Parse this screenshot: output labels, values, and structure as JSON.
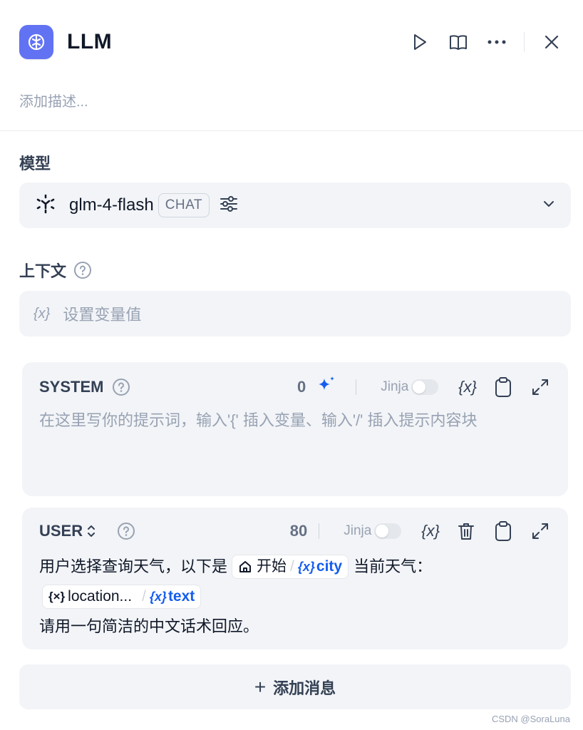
{
  "header": {
    "title": "LLM",
    "description_placeholder": "添加描述..."
  },
  "model": {
    "label": "模型",
    "name": "glm-4-flash",
    "mode_badge": "CHAT"
  },
  "context": {
    "label": "上下文",
    "placeholder": "设置变量值",
    "var_glyph": "{x}"
  },
  "system_prompt": {
    "role": "SYSTEM",
    "count": "0",
    "jinja_label": "Jinja",
    "var_glyph": "{x}",
    "placeholder": "在这里写你的提示词，输入'{' 插入变量、输入'/' 插入提示内容块"
  },
  "user_prompt": {
    "role": "USER",
    "count": "80",
    "jinja_label": "Jinja",
    "var_glyph": "{x}",
    "line1_prefix": "用户选择查询天气，以下是",
    "chip1_node": "开始",
    "chip1_var": "city",
    "line1_suffix": "当前天气：",
    "chip2_node": "location...",
    "chip2_var": "text",
    "line3": "请用一句简洁的中文话术回应。",
    "chip_var_glyph": "{x}",
    "chip_node_glyph": "{×}"
  },
  "add_message": {
    "plus": "+",
    "label": "添加消息"
  },
  "watermark": "CSDN @SoraLuna",
  "colors": {
    "accent": "#155eef",
    "app_icon": "#6172f3"
  }
}
